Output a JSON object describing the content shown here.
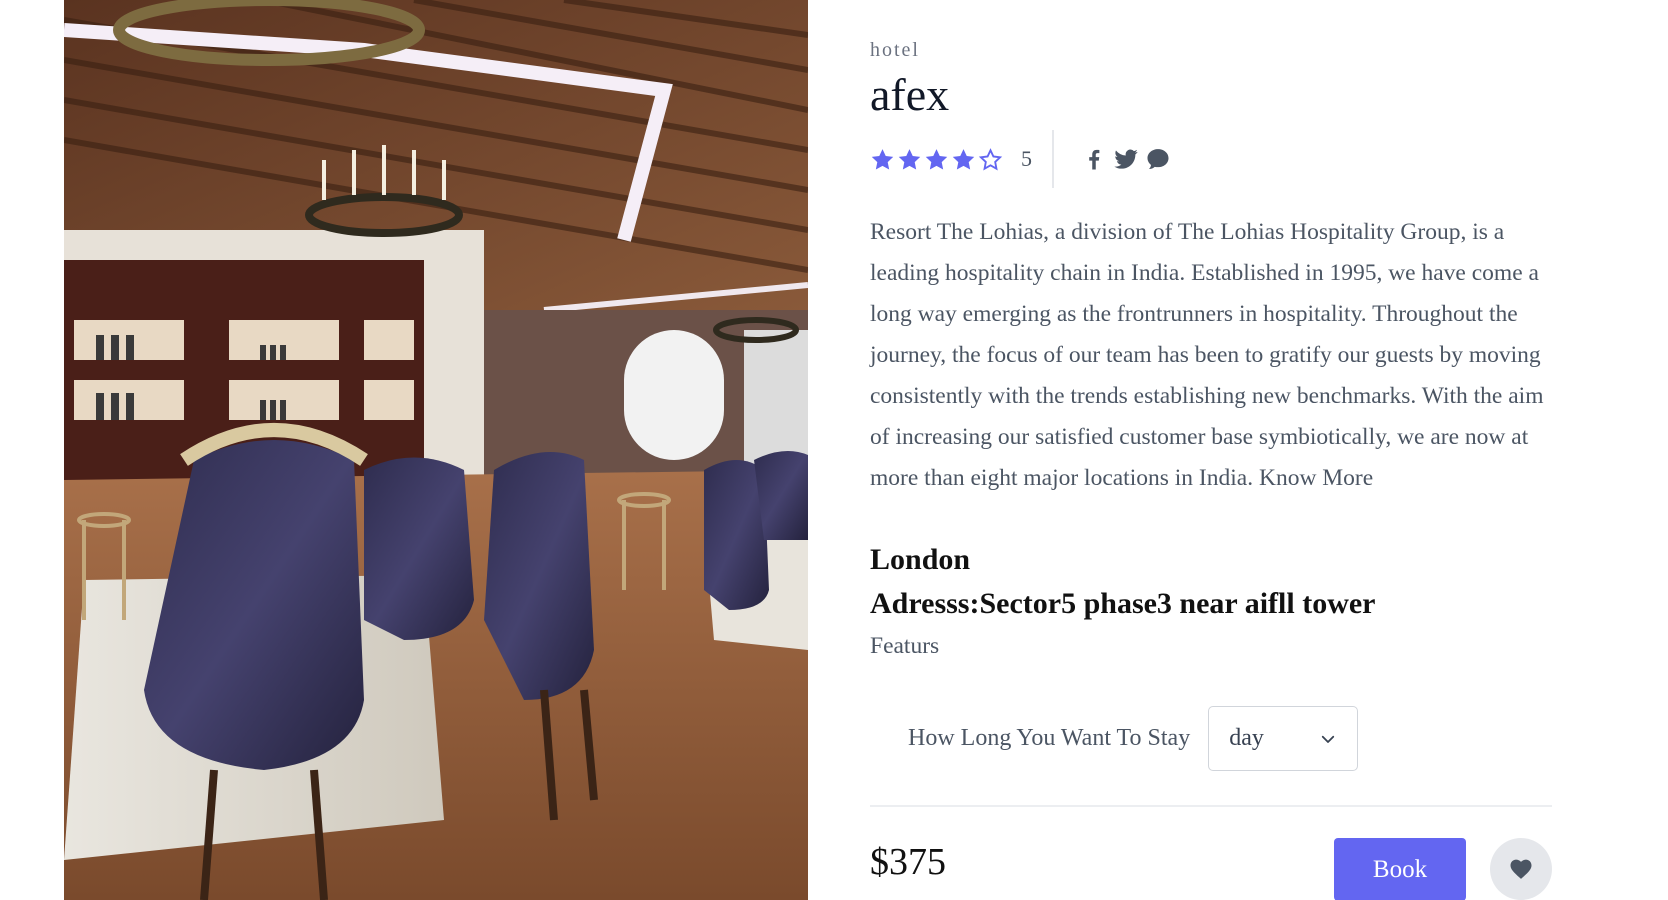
{
  "product": {
    "category": "hotel",
    "name": "afex",
    "rating": {
      "stars_filled": 4,
      "stars_total": 5,
      "count_label": "5"
    },
    "socials": [
      {
        "name": "facebook",
        "icon": "facebook-icon"
      },
      {
        "name": "twitter",
        "icon": "twitter-icon"
      },
      {
        "name": "messenger",
        "icon": "chat-bubble-icon"
      }
    ],
    "description": "Resort The Lohias, a division of The Lohias Hospitality Group, is a leading hospitality chain in India. Established in 1995, we have come a long way emerging as the frontrunners in hospitality. Throughout the journey, the focus of our team has been to gratify our guests by moving consistently with the trends establishing new benchmarks. With the aim of increasing our satisfied customer base symbiotically, we are now at more than eight major locations in India.",
    "know_more": "Know More",
    "city": "London",
    "address": "Adresss:Sector5 phase3 near aifll tower",
    "features_label": "Featurs",
    "stay": {
      "label": "How Long You Want To Stay",
      "selected": "day"
    },
    "price": "$375",
    "book_label": "Book"
  },
  "colors": {
    "accent": "#6366f1",
    "star": "#6366f1",
    "muted_text": "#4b5563",
    "fav_bg": "#e5e7eb",
    "icon": "#4b5563"
  },
  "image": {
    "subject": "hotel restaurant interior photo"
  }
}
